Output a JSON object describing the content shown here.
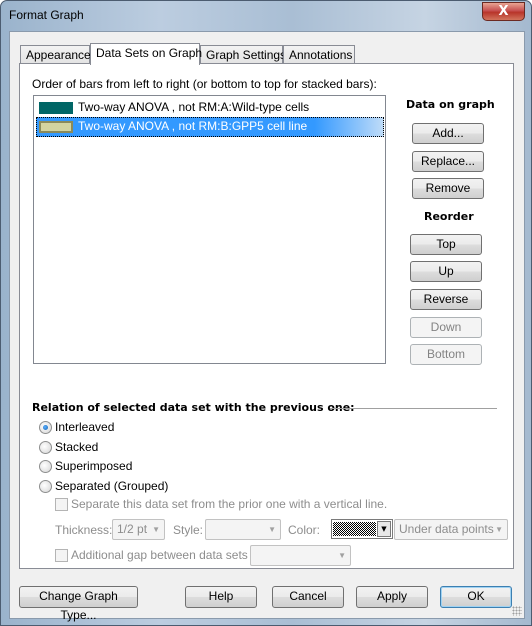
{
  "window": {
    "title": "Format Graph",
    "close_label": "X"
  },
  "tabs": [
    {
      "label": "Appearance",
      "active": false
    },
    {
      "label": "Data Sets on Graph",
      "active": true
    },
    {
      "label": "Graph Settings",
      "active": false
    },
    {
      "label": "Annotations",
      "active": false
    }
  ],
  "data_sets": {
    "heading": "Order of bars from left to right (or bottom to top for stacked bars):",
    "items": [
      {
        "label": "Two-way ANOVA , not RM:A:Wild-type cells",
        "swatch_color": "#006666",
        "selected": false
      },
      {
        "label": "Two-way ANOVA , not RM:B:GPP5 cell line",
        "swatch_color": "#d4d4a0",
        "swatch_border": "#8a8a5a",
        "selected": true
      }
    ]
  },
  "data_on_graph": {
    "title": "Data on graph",
    "add_label": "Add...",
    "replace_label": "Replace...",
    "remove_label": "Remove"
  },
  "reorder": {
    "title": "Reorder",
    "top_label": "Top",
    "up_label": "Up",
    "reverse_label": "Reverse",
    "down_label": "Down",
    "bottom_label": "Bottom"
  },
  "relation": {
    "title": "Relation of selected data set with the previous one:",
    "options": [
      {
        "label": "Interleaved",
        "checked": true
      },
      {
        "label": "Stacked",
        "checked": false
      },
      {
        "label": "Superimposed",
        "checked": false
      },
      {
        "label": "Separated (Grouped)",
        "checked": false
      }
    ],
    "separate_line_label": "Separate this data set from the prior one with a vertical line.",
    "thickness_label": "Thickness:",
    "thickness_value": "1/2 pt",
    "style_label": "Style:",
    "style_value": "",
    "color_label": "Color:",
    "position_value": "Under data points",
    "additional_gap_label": "Additional gap between data sets",
    "additional_gap_value": ""
  },
  "footer": {
    "change_graph_type_label": "Change Graph Type...",
    "help_label": "Help",
    "cancel_label": "Cancel",
    "apply_label": "Apply",
    "ok_label": "OK"
  }
}
